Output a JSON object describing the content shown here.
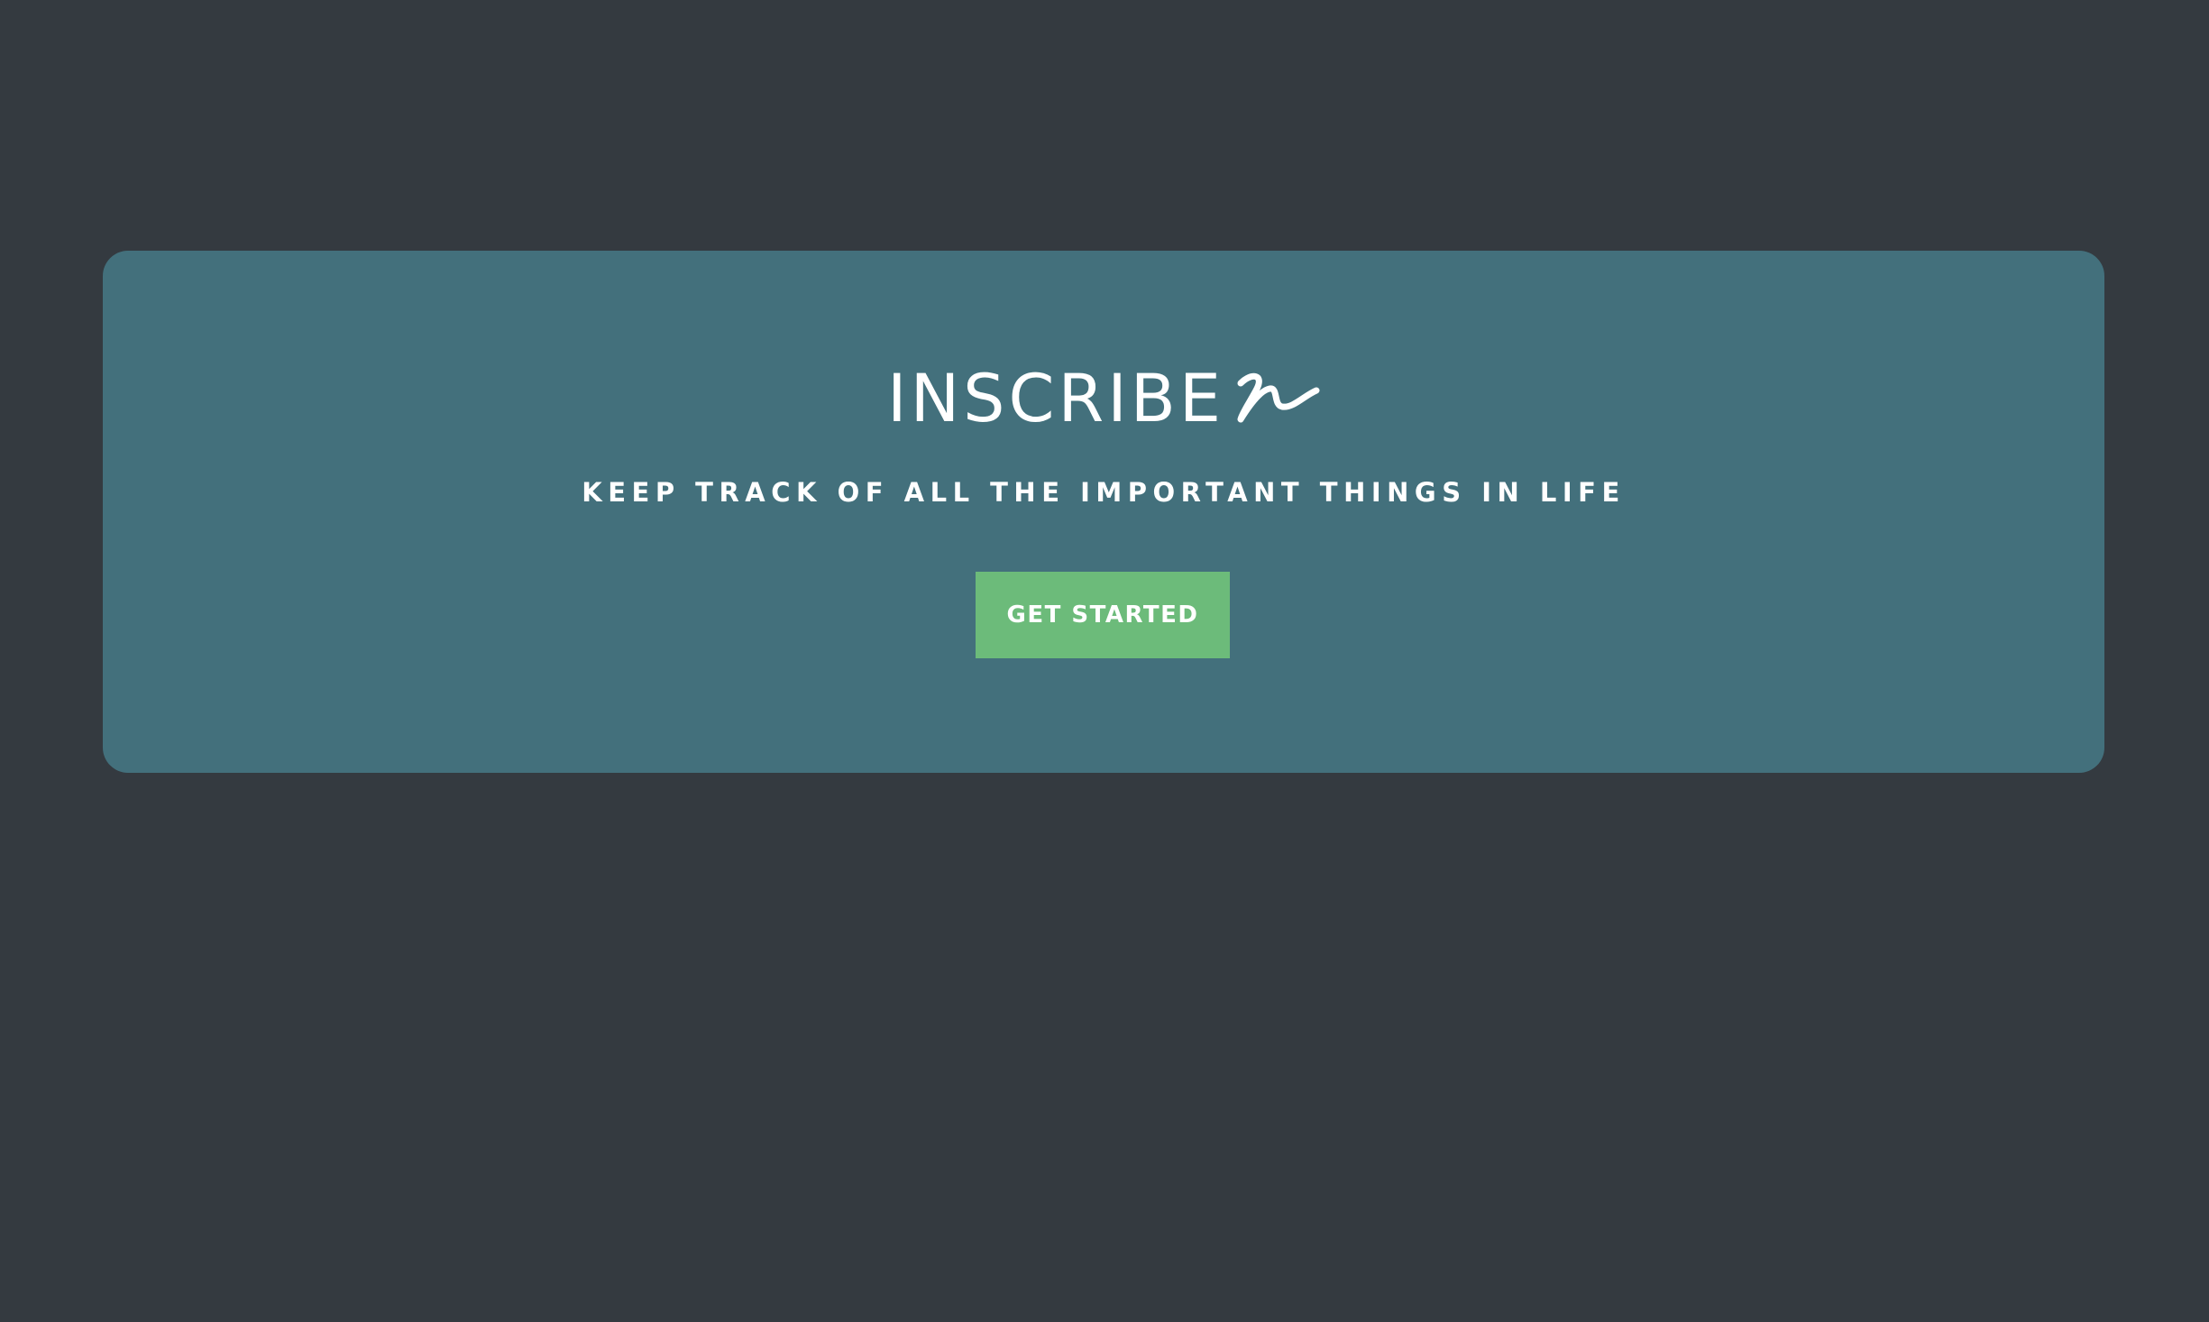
{
  "hero": {
    "brand_name": "INSCRIBE",
    "brand_mark_icon": "handwritten-scribble-icon",
    "tagline": "KEEP TRACK OF ALL THE IMPORTANT THINGS IN LIFE",
    "cta_label": "GET STARTED"
  },
  "colors": {
    "background": "#343a40",
    "hero_panel": "#43707c",
    "cta_button": "#6cbb7a",
    "text": "#ffffff"
  }
}
